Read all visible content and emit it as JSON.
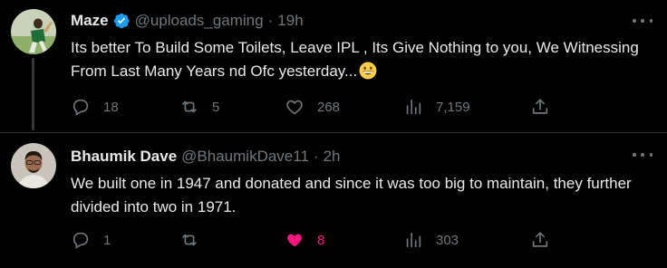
{
  "colors": {
    "background": "#000000",
    "text": "#e7e9ea",
    "muted": "#71767b",
    "verified": "#1d9bf0",
    "like_active": "#f91880"
  },
  "tweets": [
    {
      "display_name": "Maze",
      "verified": true,
      "handle": "@uploads_gaming",
      "separator": "·",
      "time": "19h",
      "text": "Its better To Build Some Toilets, Leave IPL , Its Give Nothing to you, We Witnessing From Last Many Years nd Ofc yesterday...",
      "text_emoji": "grinning-face-icon",
      "actions": {
        "reply": {
          "icon": "reply-icon",
          "count": "18"
        },
        "retweet": {
          "icon": "retweet-icon",
          "count": "5"
        },
        "like": {
          "icon": "heart-icon",
          "count": "268",
          "liked": false
        },
        "views": {
          "icon": "views-icon",
          "count": "7,159"
        },
        "share": {
          "icon": "share-icon"
        }
      }
    },
    {
      "display_name": "Bhaumik Dave",
      "verified": false,
      "handle": "@BhaumikDave11",
      "separator": "·",
      "time": "2h",
      "text": "We built one in 1947 and donated and since it was too big to maintain, they further divided into two in 1971.",
      "actions": {
        "reply": {
          "icon": "reply-icon",
          "count": "1"
        },
        "retweet": {
          "icon": "retweet-icon",
          "count": ""
        },
        "like": {
          "icon": "heart-icon",
          "count": "8",
          "liked": true
        },
        "views": {
          "icon": "views-icon",
          "count": "303"
        },
        "share": {
          "icon": "share-icon"
        }
      }
    }
  ]
}
